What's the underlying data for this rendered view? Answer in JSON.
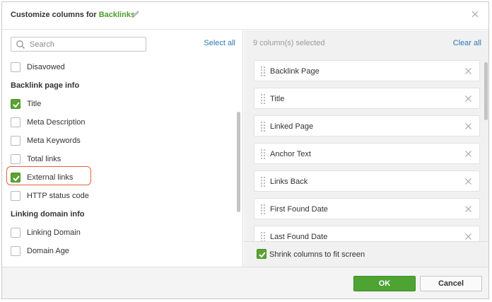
{
  "header": {
    "title_prefix": "Customize columns for",
    "title_accent": "Backlinks"
  },
  "left_panel": {
    "search_placeholder": "Search",
    "select_all": "Select all",
    "items": [
      {
        "kind": "option",
        "label": "Disavowed",
        "checked": false
      },
      {
        "kind": "section",
        "label": "Backlink page info"
      },
      {
        "kind": "option",
        "label": "Title",
        "checked": true
      },
      {
        "kind": "option",
        "label": "Meta Description",
        "checked": false
      },
      {
        "kind": "option",
        "label": "Meta Keywords",
        "checked": false
      },
      {
        "kind": "option",
        "label": "Total links",
        "checked": false
      },
      {
        "kind": "option",
        "label": "External links",
        "checked": true,
        "highlighted": true
      },
      {
        "kind": "option",
        "label": "HTTP status code",
        "checked": false
      },
      {
        "kind": "section",
        "label": "Linking domain info"
      },
      {
        "kind": "option",
        "label": "Linking Domain",
        "checked": false
      },
      {
        "kind": "option",
        "label": "Domain Age",
        "checked": false
      }
    ]
  },
  "right_panel": {
    "selected_count": "9 column(s) selected",
    "clear_all": "Clear all",
    "selected": [
      "Backlink Page",
      "Title",
      "Linked Page",
      "Anchor Text",
      "Links Back",
      "First Found Date",
      "Last Found Date"
    ],
    "shrink_label": "Shrink columns to fit screen",
    "shrink_checked": true
  },
  "footer": {
    "ok": "OK",
    "cancel": "Cancel"
  },
  "colors": {
    "accent_green": "#4da433",
    "link_blue": "#2a7ab8",
    "highlight_orange": "#e8603a"
  }
}
